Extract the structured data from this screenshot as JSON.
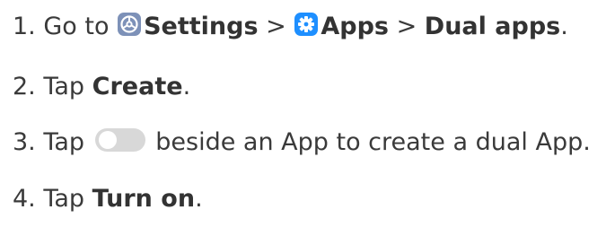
{
  "steps": [
    {
      "number": "1.",
      "prefix": "Go to",
      "settings_label": "Settings",
      "sep1": ">",
      "apps_label": "Apps",
      "sep2": ">",
      "dual_apps_label": "Dual apps",
      "end": "."
    },
    {
      "number": "2.",
      "prefix": "Tap",
      "create_label": "Create",
      "end": "."
    },
    {
      "number": "3.",
      "prefix": "Tap",
      "suffix": "beside an App to create a dual App."
    },
    {
      "number": "4.",
      "prefix": "Tap",
      "turn_on_label": "Turn on",
      "end": "."
    }
  ],
  "icons": {
    "settings": "settings-gear-icon",
    "apps": "apps-gear-icon",
    "toggle": "toggle-switch-off"
  },
  "colors": {
    "text": "#3a3a3a",
    "settings_icon_bg": "#7d91b8",
    "apps_icon_bg": "#1e8fff",
    "toggle_track": "#d8d8d8"
  }
}
